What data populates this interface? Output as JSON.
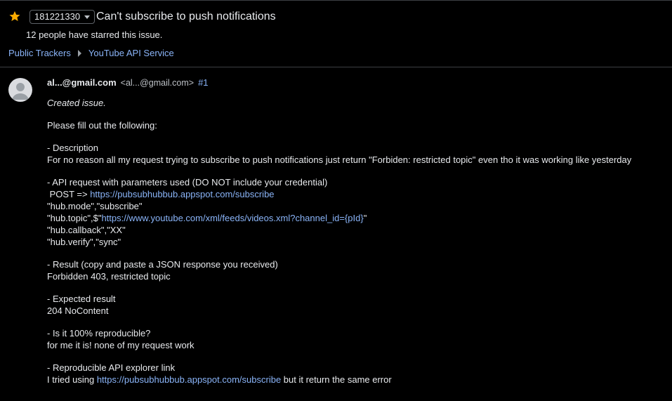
{
  "issue": {
    "id": "181221330",
    "title": "Can't subscribe to push notifications",
    "stars_text": "12 people have starred this issue."
  },
  "breadcrumbs": [
    "Public Trackers",
    "YouTube API Service"
  ],
  "colors": {
    "star": "#f9ab00",
    "link": "#8ab4f8",
    "background": "#000000"
  },
  "comment": {
    "author": "al...@gmail.com",
    "author_email": "<al...@gmail.com>",
    "number": "#1",
    "created": "Created issue.",
    "intro": "Please fill out the following:",
    "desc_header": "- Description",
    "desc_text": "For no reason all my request trying to subscribe to push notifications just return \"Forbiden: restricted topic\" even tho it was working like yesterday",
    "api_header": "- API request with parameters used (DO NOT include your credential)",
    "post_prefix": " POST => ",
    "post_url": "https://pubsubhubbub.appspot.com/subscribe",
    "hub_mode": "\"hub.mode\",\"subscribe\"",
    "hub_topic_prefix": "\"hub.topic\",$\"",
    "hub_topic_url": "https://www.youtube.com/xml/feeds/videos.xml?channel_id={pId}",
    "hub_topic_suffix": "\"",
    "hub_callback": "\"hub.callback\",\"XX\"",
    "hub_verify": "\"hub.verify\",\"sync\"",
    "result_header": "- Result (copy and paste a JSON response you received)",
    "result_text": "Forbidden 403, restricted topic",
    "expected_header": "- Expected result",
    "expected_text": "204 NoContent",
    "repro_header": "- Is it 100% reproducible?",
    "repro_text": "for me it is! none of my request work",
    "explorer_header": "- Reproducible API explorer link",
    "explorer_prefix": "I tried using ",
    "explorer_url": "https://pubsubhubbub.appspot.com/subscribe",
    "explorer_suffix": " but it return the same error"
  }
}
